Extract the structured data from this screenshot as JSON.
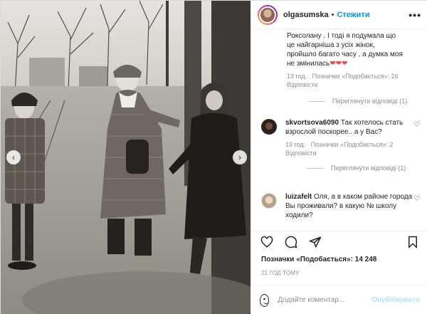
{
  "post": {
    "username": "olgasumska",
    "separator": "•",
    "follow_label": "Стежити",
    "more_label": "•••"
  },
  "comments": [
    {
      "text_line1": "Роксолану . І тоді я подумала що",
      "text_line2": "це найгарніша з усіх жінок,",
      "text_line3": "пройшло багато часу , а думка моя",
      "text_line4": "не змінилась",
      "hearts": "❤❤❤",
      "time": "19 год.",
      "likes": "Позначки «Подобається»: 16",
      "reply": "Відповісти",
      "view_replies": "Переглянути відповіді (1)"
    },
    {
      "username": "skvortsova6090",
      "text": "Так хотелось стать взрослой поскорее.. а у Вас?",
      "time": "19 год.",
      "likes": "Позначки «Подобається»: 2",
      "reply": "Відповісти",
      "view_replies": "Переглянути відповіді (1)"
    },
    {
      "username": "luizafelt",
      "text": "Оля, а в каком районе города Вы проживали? в какую № школу ходили?"
    }
  ],
  "likes_total": "Позначки «Подобається»: 14 248",
  "time_ago": "21 ГОД ТОМУ",
  "comment_box": {
    "placeholder": "Додайте коментар...",
    "publish_label": "Опублікувати"
  },
  "nav": {
    "prev": "‹",
    "next": "›"
  },
  "icons": [
    "heart-icon",
    "comment-icon",
    "share-icon",
    "bookmark-icon",
    "emoji-icon",
    "more-icon"
  ],
  "colors": {
    "link": "#0095f6",
    "heart": "#ed4956",
    "muted": "#8e8e8e",
    "publish_disabled": "#b2dffc"
  }
}
